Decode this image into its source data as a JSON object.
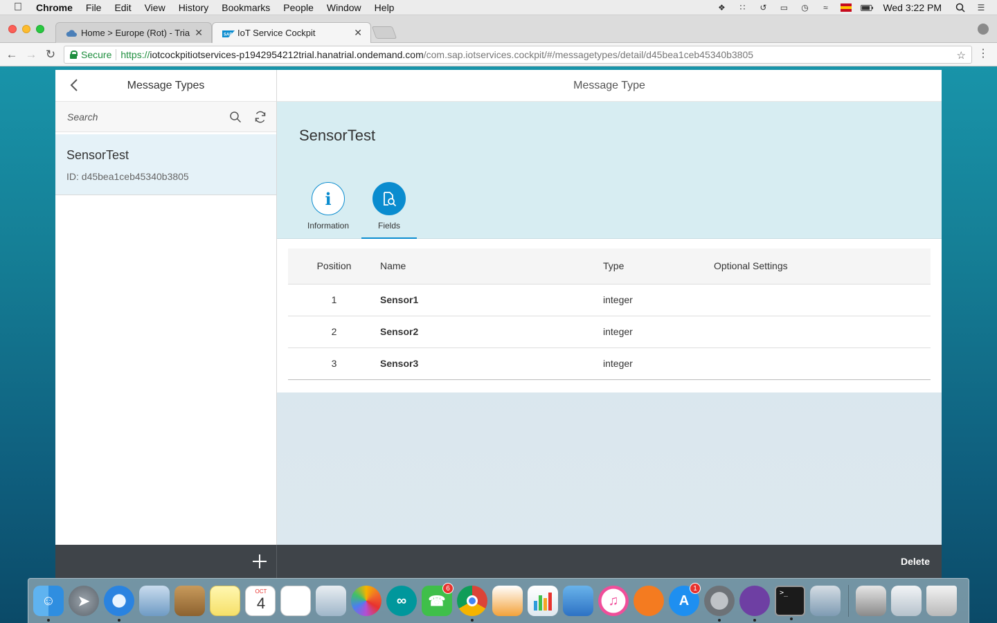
{
  "menubar": {
    "app_name": "Chrome",
    "items": [
      "File",
      "Edit",
      "View",
      "History",
      "Bookmarks",
      "People",
      "Window",
      "Help"
    ],
    "clock": "Wed 3:22 PM"
  },
  "browser": {
    "tabs": [
      {
        "title": "Home > Europe (Rot) - Trial > ",
        "active": false
      },
      {
        "title": "IoT Service Cockpit",
        "active": true
      }
    ],
    "secure_label": "Secure",
    "url_scheme": "https://",
    "url_host": "iotcockpitiotservices-p1942954212trial.hanatrial.ondemand.com",
    "url_path": "/com.sap.iotservices.cockpit/#/messagetypes/detail/d45bea1ceb45340b3805"
  },
  "master": {
    "title": "Message Types",
    "search_placeholder": "Search",
    "items": [
      {
        "title": "SensorTest",
        "subtitle": "ID: d45bea1ceb45340b3805"
      }
    ]
  },
  "detail": {
    "title": "Message Type",
    "object_title": "SensorTest",
    "tabs": [
      {
        "label": "Information",
        "icon": "info-icon"
      },
      {
        "label": "Fields",
        "icon": "fields-search-icon",
        "selected": true
      }
    ],
    "table": {
      "columns": [
        "Position",
        "Name",
        "Type",
        "Optional Settings"
      ],
      "rows": [
        {
          "position": "1",
          "name": "Sensor1",
          "type": "integer",
          "optional": ""
        },
        {
          "position": "2",
          "name": "Sensor2",
          "type": "integer",
          "optional": ""
        },
        {
          "position": "3",
          "name": "Sensor3",
          "type": "integer",
          "optional": ""
        }
      ]
    },
    "delete_label": "Delete"
  },
  "dock": {
    "calendar_month": "OCT",
    "calendar_day": "4",
    "facetime_badge": "6",
    "appstore_badge": "1"
  },
  "colors": {
    "accent": "#0a8ccf",
    "footer_bg": "#3f4449",
    "object_header_bg": "#d7edf2",
    "selected_item_bg": "#e5f2f8"
  }
}
